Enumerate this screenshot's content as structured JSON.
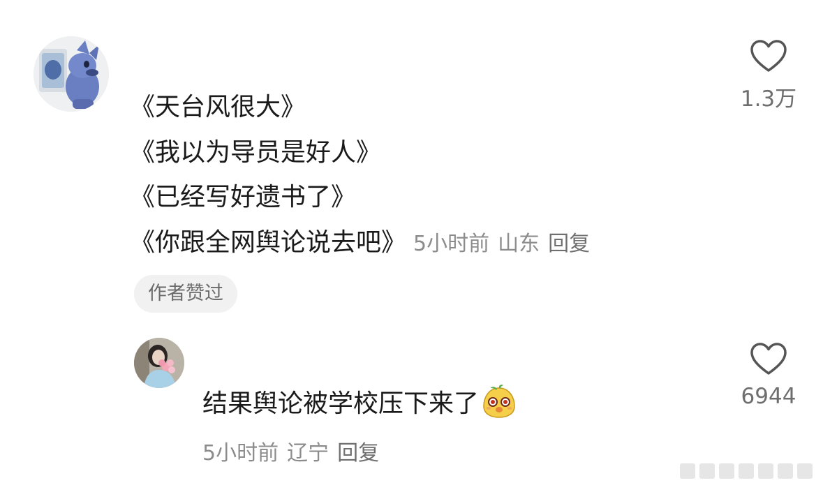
{
  "comment": {
    "avatar_icon": "stitch-figure-avatar",
    "lines": [
      "《天台风很大》",
      "《我以为导员是好人》",
      "《已经写好遗书了》",
      "《你跟全网舆论说去吧》"
    ],
    "time": "5小时前",
    "location": "山东",
    "reply_label": "回复",
    "author_liked_badge": "作者赞过",
    "like_icon": "heart-outline-icon",
    "like_count": "1.3万"
  },
  "reply": {
    "avatar_icon": "girl-with-flowers-avatar",
    "text": "结果舆论被学校压下来了",
    "emoji": "surprised-bean-emoji",
    "time": "5小时前",
    "location": "辽宁",
    "reply_label": "回复",
    "like_icon": "heart-outline-icon",
    "like_count": "6944"
  },
  "colors": {
    "text_primary": "#1a1a1a",
    "text_secondary": "#8c8c8c",
    "badge_bg": "#f1f1f1",
    "icon_stroke": "#555555"
  }
}
